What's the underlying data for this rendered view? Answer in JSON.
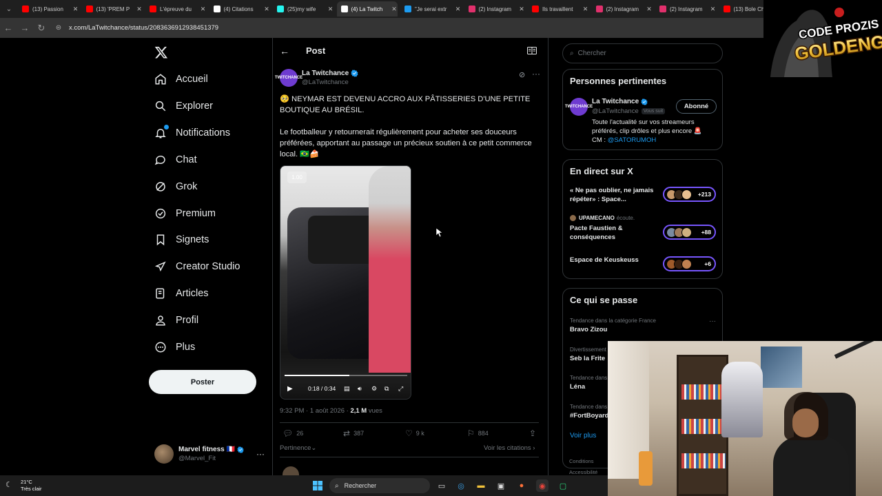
{
  "browser": {
    "tabs": [
      {
        "label": "(13) Passion",
        "color": "#ff0000",
        "active": false
      },
      {
        "label": "(13) 'PREM P",
        "color": "#ff0000",
        "active": false
      },
      {
        "label": "L'épreuve du",
        "color": "#ff0000",
        "active": false
      },
      {
        "label": "(4) Citations",
        "color": "#ffffff",
        "active": false
      },
      {
        "label": "(25)my wife",
        "color": "#25f4ee",
        "active": false
      },
      {
        "label": "(4) La Twitch",
        "color": "#ffffff",
        "active": true
      },
      {
        "label": "\"Je serai extr",
        "color": "#1d9bf0",
        "active": false
      },
      {
        "label": "(2) Instagram",
        "color": "#e1306c",
        "active": false
      },
      {
        "label": "Ils travaillent",
        "color": "#ff0000",
        "active": false
      },
      {
        "label": "(2) Instagram",
        "color": "#e1306c",
        "active": false
      },
      {
        "label": "(2) Instagram",
        "color": "#e1306c",
        "active": false
      },
      {
        "label": "(13) Bole Ch",
        "color": "#ff0000",
        "active": false
      }
    ],
    "url": "x.com/LaTwitchance/status/2083636912938451379"
  },
  "nav": {
    "items": [
      {
        "label": "Accueil",
        "icon": "home-icon"
      },
      {
        "label": "Explorer",
        "icon": "search-icon"
      },
      {
        "label": "Notifications",
        "icon": "bell-icon"
      },
      {
        "label": "Chat",
        "icon": "chat-icon"
      },
      {
        "label": "Grok",
        "icon": "grok-icon"
      },
      {
        "label": "Premium",
        "icon": "premium-icon"
      },
      {
        "label": "Signets",
        "icon": "bookmark-icon"
      },
      {
        "label": "Creator Studio",
        "icon": "rocket-icon"
      },
      {
        "label": "Articles",
        "icon": "article-icon"
      },
      {
        "label": "Profil",
        "icon": "profile-icon"
      },
      {
        "label": "Plus",
        "icon": "more-circle-icon"
      }
    ],
    "post_button": "Poster",
    "account": {
      "name": "Marvel fitness",
      "flag": "🇫🇷",
      "handle": "@Marvel_Fit"
    }
  },
  "post": {
    "header_title": "Post",
    "author_name": "La Twitchance",
    "author_handle": "@LaTwitchance",
    "avatar_text": "TWITCHANCE",
    "text_1": "🥺 NEYMAR EST DEVENU ACCRO AUX PÂTISSERIES D'UNE PETITE BOUTIQUE AU BRÉSIL.",
    "text_2": "Le footballeur y retournerait régulièrement pour acheter ses douceurs préférées, apportant au passage un précieux soutien à ce petit commerce local. 🇧🇷🍰",
    "video": {
      "speed": "1.00",
      "time": "0:18 / 0:34",
      "progress": 0.53
    },
    "meta_time": "9:32 PM · 1 août 2026 · ",
    "meta_views": "2,1 M",
    "meta_views_label": " vues",
    "stats": {
      "replies": "26",
      "reposts": "387",
      "likes": "9 k",
      "bookmarks": "884"
    },
    "relevance": "Pertinence",
    "quotes_link": "Voir les citations"
  },
  "sidebar": {
    "search_placeholder": "Chercher",
    "relevant": {
      "title": "Personnes pertinentes",
      "name": "La Twitchance",
      "handle": "@LaTwitchance",
      "follows_you": "Vous suit",
      "follow_button": "Abonné",
      "bio": "Toute l'actualité sur vos streameurs préférés, clip drôles et plus encore 🚨",
      "bio_cm": "CM : ",
      "bio_link": "@SATORUMOH"
    },
    "live": {
      "title": "En direct sur X",
      "spaces": [
        {
          "title": "« Ne pas oublier, ne jamais répéter» : Space...",
          "count": "+213",
          "host": "",
          "host_suffix": ""
        },
        {
          "title": "Pacte Faustien & conséquences",
          "count": "+88",
          "host": "UPAMECANO",
          "host_suffix": "écoute."
        },
        {
          "title": "Espace de Keuskeuss",
          "count": "+6",
          "host": "",
          "host_suffix": ""
        }
      ]
    },
    "trends": {
      "title": "Ce qui se passe",
      "items": [
        {
          "category": "Tendance dans la catégorie France",
          "name": "Bravo Zizou"
        },
        {
          "category": "Divertissement",
          "name": "Seb la Frite"
        },
        {
          "category": "Tendance dans",
          "name": "Léna"
        },
        {
          "category": "Tendance dans",
          "name": "#FortBoyard"
        }
      ],
      "see_more": "Voir plus"
    },
    "footer": [
      "Conditions",
      "Accessibilité"
    ]
  },
  "taskbar": {
    "temp": "21°C",
    "weather": "Très clair",
    "search": "Rechercher"
  },
  "overlay": {
    "logo_line1": "CODE PROZIS",
    "logo_line2": "GOLDENG"
  },
  "colors": {
    "accent": "#1d9bf0",
    "spaces": "#7856ff"
  }
}
